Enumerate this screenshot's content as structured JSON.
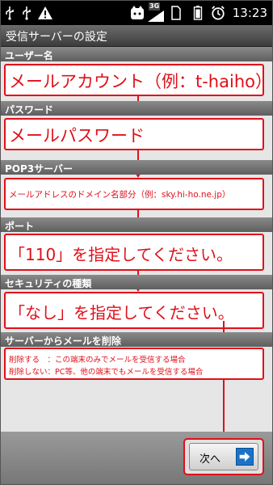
{
  "statusbar": {
    "network": "3G",
    "time": "13:23"
  },
  "title": "受信サーバーの設定",
  "sections": [
    {
      "label": "ユーザー名",
      "value": "メールアカウント（例：t-haiho）"
    },
    {
      "label": "パスワード",
      "value": "メールパスワード"
    },
    {
      "label": "POP3サーバー",
      "value": "メールアドレスのドメイン名部分（例：sky.hi-ho.ne.jp）"
    },
    {
      "label": "ポート",
      "value": "「110」を指定してください。"
    },
    {
      "label": "セキュリティの種類",
      "value": "「なし」を指定してください。"
    },
    {
      "label": "サーバーからメールを削除"
    }
  ],
  "delete_info": {
    "line1": "削除する　：この端末のみでメールを受信する場合",
    "line2": "削除しない：PC等、他の端末でもメールを受信する場合"
  },
  "next_button": {
    "label": "次へ"
  },
  "colors": {
    "accent": "#e0101a",
    "button_icon": "#1a73c8"
  }
}
